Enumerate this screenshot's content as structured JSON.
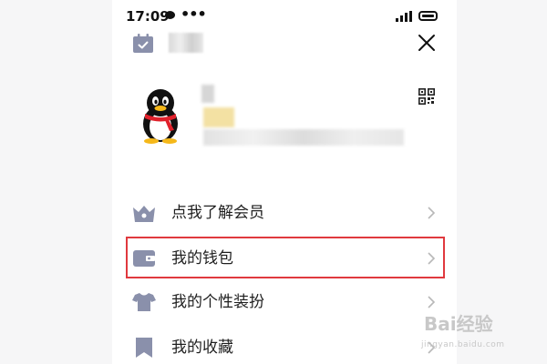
{
  "status_bar": {
    "time": "17:09",
    "dots": "•••"
  },
  "menu": {
    "items": [
      {
        "label": "点我了解会员"
      },
      {
        "label": "我的钱包"
      },
      {
        "label": "我的个性装扮"
      },
      {
        "label": "我的收藏"
      }
    ]
  },
  "watermark": {
    "text": "Bai经验",
    "sub": "jingyan.baidu.com"
  },
  "colors": {
    "icon": "#8a90ab",
    "highlight": "#e0393e",
    "text": "#1f1f1f"
  }
}
